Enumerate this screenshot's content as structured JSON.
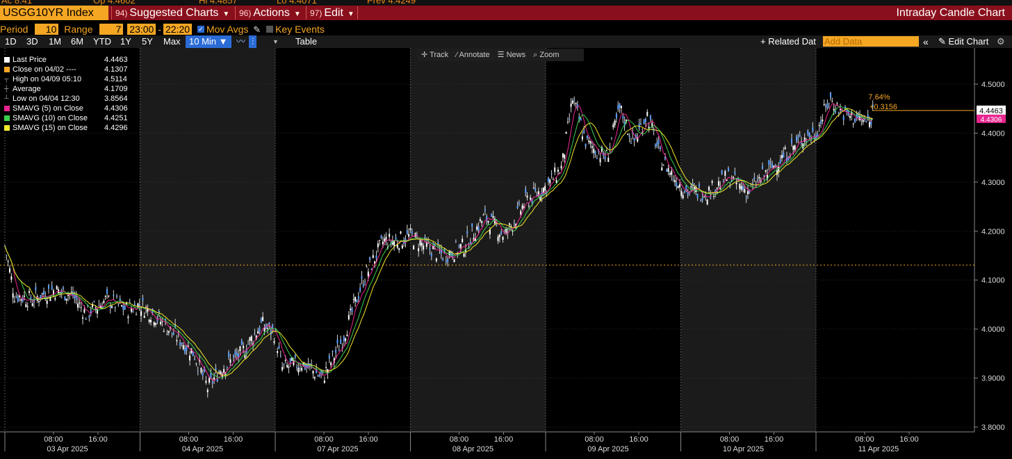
{
  "top_strip": [
    {
      "text": "Ac 8.41"
    },
    {
      "text": "Op 4.4602"
    },
    {
      "text": "Hi 4.4857"
    },
    {
      "text": "Lo 4.4071"
    },
    {
      "text": "Prev 4.4249"
    }
  ],
  "header": {
    "ticker": "USGG10YR Index",
    "menus": [
      {
        "num": "94)",
        "label": "Suggested Charts"
      },
      {
        "num": "96)",
        "label": "Actions"
      },
      {
        "num": "97)",
        "label": "Edit"
      }
    ],
    "right_title": "Intraday Candle Chart"
  },
  "settings": {
    "period_label": "Period",
    "period_value": "10",
    "range_label": "Range",
    "range_value": "7",
    "time_from": "23:00",
    "dash": "-",
    "time_to": "22:20",
    "mov_avgs": "Mov Avgs",
    "key_events": "Key Events"
  },
  "timeframes": [
    "1D",
    "3D",
    "1M",
    "6M",
    "YTD",
    "1Y",
    "5Y",
    "Max"
  ],
  "interval": "10 Min ▼",
  "table_label": "Table",
  "related_data": "+ Related Dat",
  "add_data_placeholder": "Add Data",
  "edit_chart": "Edit Chart",
  "toolbar": [
    "Track",
    "Annotate",
    "News",
    "Zoom"
  ],
  "legend": [
    {
      "label": "Last Price",
      "value": "4.4463",
      "color": "#ffffff"
    },
    {
      "label": "Close on 04/02 ----",
      "value": "4.1307",
      "color": "#f5a623"
    },
    {
      "label": "High on 04/09 05:10",
      "value": "4.5114",
      "color": "#888888"
    },
    {
      "label": "Average",
      "value": "4.1709",
      "color": "#888888"
    },
    {
      "label": "Low on 04/04 12:30",
      "value": "3.8564",
      "color": "#888888"
    },
    {
      "label": "SMAVG (5)  on Close",
      "value": "4.4306",
      "color": "#e8258f"
    },
    {
      "label": "SMAVG (10)  on Close",
      "value": "4.4251",
      "color": "#3ccf4e"
    },
    {
      "label": "SMAVG (15)  on Close",
      "value": "4.4296",
      "color": "#f2ea2c"
    }
  ],
  "chart_data": {
    "type": "line",
    "y_ticks": [
      "4.5000",
      "4.4000",
      "4.3000",
      "4.2000",
      "4.1000",
      "4.0000",
      "3.9000",
      "3.8000"
    ],
    "ylim": [
      3.8,
      4.5
    ],
    "prev_close_line": 4.1307,
    "last_price_label": "4.4463",
    "sma_label": "4.4306",
    "change_pct": "7.64%",
    "change_abs": "+0.3156",
    "days": [
      {
        "date": "03 Apr 2025",
        "ticks": [
          "08:00",
          "16:00"
        ]
      },
      {
        "date": "04 Apr 2025",
        "ticks": [
          "08:00",
          "16:00"
        ]
      },
      {
        "date": "07 Apr 2025",
        "ticks": [
          "08:00",
          "16:00"
        ]
      },
      {
        "date": "08 Apr 2025",
        "ticks": [
          "08:00",
          "16:00"
        ]
      },
      {
        "date": "09 Apr 2025",
        "ticks": [
          "08:00",
          "16:00"
        ]
      },
      {
        "date": "10 Apr 2025",
        "ticks": [
          "08:00",
          "16:00"
        ]
      },
      {
        "date": "11 Apr 2025",
        "ticks": [
          "08:00",
          "16:00"
        ]
      }
    ],
    "price_points": [
      [
        0,
        4.17
      ],
      [
        0.07,
        4.07
      ],
      [
        0.2,
        4.06
      ],
      [
        0.35,
        4.08
      ],
      [
        0.5,
        4.07
      ],
      [
        0.6,
        4.03
      ],
      [
        0.75,
        4.06
      ],
      [
        0.9,
        4.04
      ],
      [
        1.0,
        4.05
      ],
      [
        1.1,
        4.03
      ],
      [
        1.25,
        3.99
      ],
      [
        1.4,
        3.95
      ],
      [
        1.5,
        3.88
      ],
      [
        1.6,
        3.92
      ],
      [
        1.75,
        3.95
      ],
      [
        1.9,
        4.01
      ],
      [
        2.0,
        3.99
      ],
      [
        2.05,
        3.92
      ],
      [
        2.2,
        3.93
      ],
      [
        2.35,
        3.9
      ],
      [
        2.5,
        3.98
      ],
      [
        2.65,
        4.1
      ],
      [
        2.8,
        4.18
      ],
      [
        2.9,
        4.18
      ],
      [
        3.0,
        4.19
      ],
      [
        3.1,
        4.17
      ],
      [
        3.25,
        4.15
      ],
      [
        3.4,
        4.17
      ],
      [
        3.55,
        4.23
      ],
      [
        3.7,
        4.19
      ],
      [
        3.85,
        4.26
      ],
      [
        3.95,
        4.28
      ],
      [
        4.0,
        4.29
      ],
      [
        4.12,
        4.33
      ],
      [
        4.2,
        4.47
      ],
      [
        4.3,
        4.38
      ],
      [
        4.45,
        4.35
      ],
      [
        4.55,
        4.45
      ],
      [
        4.65,
        4.38
      ],
      [
        4.75,
        4.44
      ],
      [
        4.85,
        4.35
      ],
      [
        4.95,
        4.31
      ],
      [
        5.05,
        4.28
      ],
      [
        5.2,
        4.28
      ],
      [
        5.35,
        4.31
      ],
      [
        5.5,
        4.28
      ],
      [
        5.6,
        4.31
      ],
      [
        5.75,
        4.35
      ],
      [
        5.9,
        4.39
      ],
      [
        6.0,
        4.4
      ],
      [
        6.1,
        4.47
      ],
      [
        6.2,
        4.44
      ],
      [
        6.3,
        4.43
      ],
      [
        6.4,
        4.42
      ],
      [
        6.42,
        4.4463
      ]
    ],
    "smavg": [
      {
        "name": "SMAVG (5)",
        "color": "#e8258f"
      },
      {
        "name": "SMAVG (10)",
        "color": "#3ccf4e"
      },
      {
        "name": "SMAVG (15)",
        "color": "#f2ea2c"
      }
    ]
  }
}
